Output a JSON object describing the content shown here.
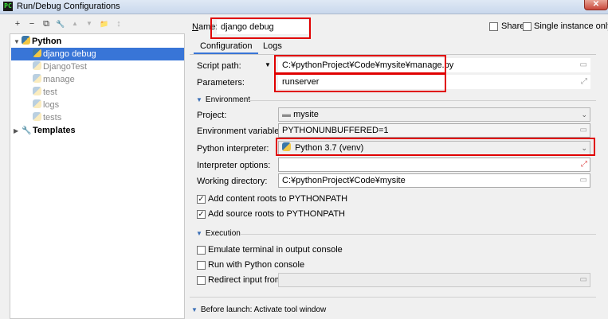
{
  "window": {
    "title": "Run/Debug Configurations",
    "close_symbol": "✕",
    "app_glyph": "PC"
  },
  "toolbar": {
    "add": "+",
    "remove": "−",
    "copy": "⧉",
    "edit": "🔧",
    "up": "▲",
    "down": "▼",
    "folder": "📁",
    "sort": "↕"
  },
  "tree": {
    "python_group": "Python",
    "items": [
      {
        "label": "django debug",
        "selected": true
      },
      {
        "label": "DjangoTest"
      },
      {
        "label": "manage"
      },
      {
        "label": "test"
      },
      {
        "label": "logs"
      },
      {
        "label": "tests"
      }
    ],
    "templates": "Templates"
  },
  "header": {
    "name_label_prefix": "N",
    "name_label_rest": "ame:",
    "name_value": "django debug",
    "share_label": "Share",
    "single_instance_label": "Single instance only"
  },
  "tabs": [
    {
      "label": "Configuration"
    },
    {
      "label": "Logs"
    }
  ],
  "config": {
    "script_path_label": "Script path:",
    "script_path_value": "C:¥pythonProject¥Code¥mysite¥manage.py",
    "parameters_label": "Parameters:",
    "parameters_value": "runserver",
    "environment_section": "Environment",
    "project_label": "Project:",
    "project_value": "mysite",
    "env_vars_label": "Environment variables:",
    "env_vars_value": "PYTHONUNBUFFERED=1",
    "interpreter_label": "Python interpreter:",
    "interpreter_value": "Python 3.7 (venv)",
    "interpreter_options_label": "Interpreter options:",
    "interpreter_options_value": "",
    "working_dir_label": "Working directory:",
    "working_dir_value": "C:¥pythonProject¥Code¥mysite",
    "add_content_roots_label": "Add content roots to PYTHONPATH",
    "add_content_roots_checked": true,
    "add_source_roots_label": "Add source roots to PYTHONPATH",
    "add_source_roots_checked": true,
    "execution_section": "Execution",
    "emulate_terminal_label": "Emulate terminal in output console",
    "run_with_console_label": "Run with Python console",
    "redirect_input_label": "Redirect input from:",
    "before_launch_label": "Before launch: Activate tool window"
  },
  "colors": {
    "selection": "#3875d7",
    "highlight_box": "#e00000"
  }
}
